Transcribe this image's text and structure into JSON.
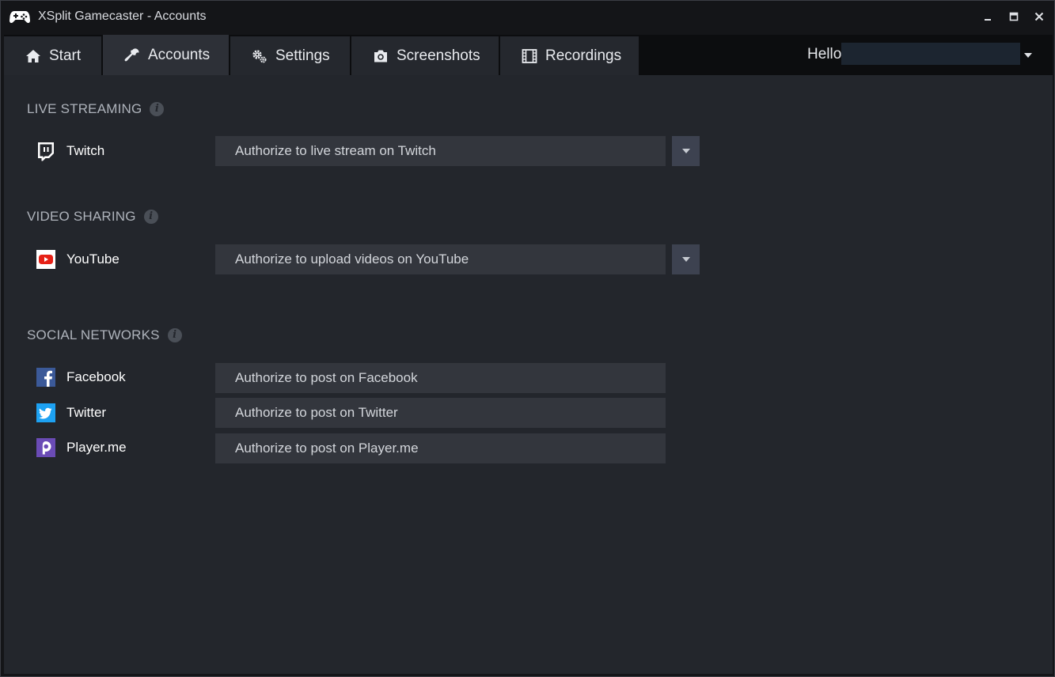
{
  "window": {
    "title": "XSplit Gamecaster - Accounts"
  },
  "tabs": [
    {
      "label": "Start",
      "icon": "home-icon"
    },
    {
      "label": "Accounts",
      "icon": "wrench-icon"
    },
    {
      "label": "Settings",
      "icon": "gears-icon"
    },
    {
      "label": "Screenshots",
      "icon": "camera-icon"
    },
    {
      "label": "Recordings",
      "icon": "film-icon"
    }
  ],
  "active_tab": "Accounts",
  "user": {
    "greeting": "Hello"
  },
  "sections": {
    "live_streaming": {
      "title": "LIVE STREAMING",
      "services": [
        {
          "name": "Twitch",
          "action": "Authorize to live stream on Twitch"
        }
      ]
    },
    "video_sharing": {
      "title": "VIDEO SHARING",
      "services": [
        {
          "name": "YouTube",
          "action": "Authorize to upload videos on YouTube"
        }
      ]
    },
    "social_networks": {
      "title": "SOCIAL NETWORKS",
      "services": [
        {
          "name": "Facebook",
          "action": "Authorize to post on Facebook"
        },
        {
          "name": "Twitter",
          "action": "Authorize to post on Twitter"
        },
        {
          "name": "Player.me",
          "action": "Authorize to post on Player.me"
        }
      ]
    }
  },
  "info_glyph": "i",
  "colors": {
    "youtube": "#e62117",
    "facebook": "#3b5998",
    "twitter": "#1da1f2",
    "playerme": "#6a4bb5"
  }
}
